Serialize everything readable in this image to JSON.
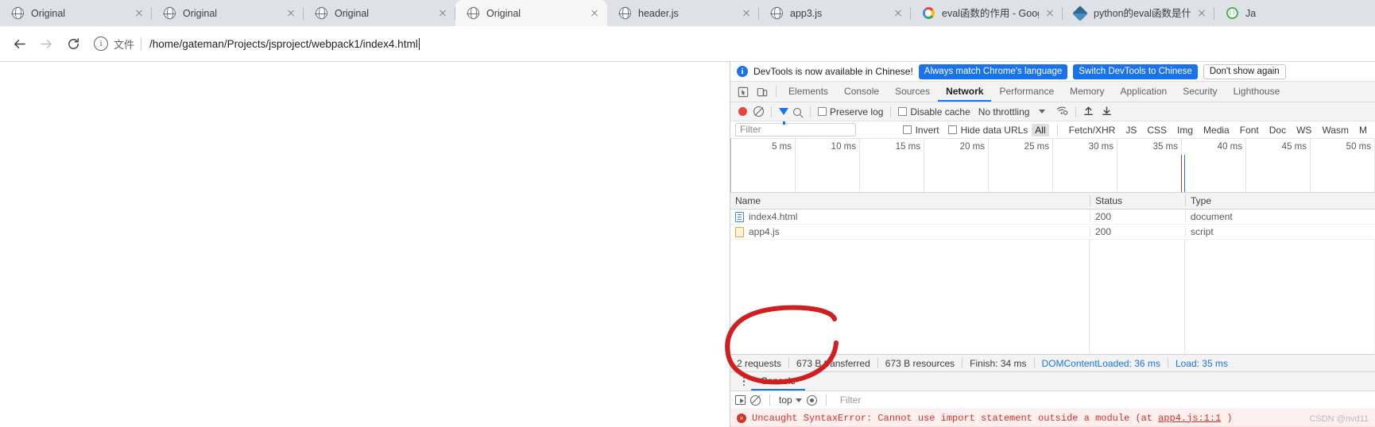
{
  "browser": {
    "tabs": [
      {
        "title": "Original",
        "icon": "globe-icon",
        "active": false
      },
      {
        "title": "Original",
        "icon": "globe-icon",
        "active": false
      },
      {
        "title": "Original",
        "icon": "globe-icon",
        "active": false
      },
      {
        "title": "Original",
        "icon": "globe-icon",
        "active": true
      },
      {
        "title": "header.js",
        "icon": "globe-icon",
        "active": false
      },
      {
        "title": "app3.js",
        "icon": "globe-icon",
        "active": false
      },
      {
        "title": "eval函数的作用 - Goog",
        "icon": "google-icon",
        "active": false
      },
      {
        "title": "python的eval函数是什",
        "icon": "python-icon",
        "active": false
      },
      {
        "title": "Ja",
        "icon": "green-circle-icon",
        "active": false
      }
    ],
    "nav": {
      "back": "←",
      "forward": "→",
      "reload": "⟳"
    },
    "omnibox": {
      "info_icon": "info-icon",
      "scheme_label": "文件",
      "url": "/home/gateman/Projects/jsproject/webpack1/index4.html"
    }
  },
  "devtools": {
    "banner": {
      "message": "DevTools is now available in Chinese!",
      "primary_button": "Always match Chrome's language",
      "secondary_button": "Switch DevTools to Chinese",
      "dismiss_button": "Don't show again"
    },
    "panel_tabs": [
      {
        "label": "Elements",
        "selected": false
      },
      {
        "label": "Console",
        "selected": false
      },
      {
        "label": "Sources",
        "selected": false
      },
      {
        "label": "Network",
        "selected": true
      },
      {
        "label": "Performance",
        "selected": false
      },
      {
        "label": "Memory",
        "selected": false
      },
      {
        "label": "Application",
        "selected": false
      },
      {
        "label": "Security",
        "selected": false
      },
      {
        "label": "Lighthouse",
        "selected": false
      }
    ],
    "network_toolbar": {
      "record_button": "record-icon",
      "clear_button": "clear-icon",
      "filter_button": "funnel-icon",
      "search_button": "search-icon",
      "preserve_log_label": "Preserve log",
      "preserve_log_checked": false,
      "disable_cache_label": "Disable cache",
      "disable_cache_checked": false,
      "throttling_value": "No throttling",
      "wifi_button": "wifi-settings-icon",
      "import_button": "import-har-icon",
      "export_button": "export-har-icon"
    },
    "filter_bar": {
      "filter_placeholder": "Filter",
      "filter_value": "",
      "invert_label": "Invert",
      "invert_checked": false,
      "hide_data_urls_label": "Hide data URLs",
      "hide_data_urls_checked": false,
      "types": [
        {
          "label": "All",
          "selected": true
        },
        {
          "label": "Fetch/XHR",
          "selected": false
        },
        {
          "label": "JS",
          "selected": false
        },
        {
          "label": "CSS",
          "selected": false
        },
        {
          "label": "Img",
          "selected": false
        },
        {
          "label": "Media",
          "selected": false
        },
        {
          "label": "Font",
          "selected": false
        },
        {
          "label": "Doc",
          "selected": false
        },
        {
          "label": "WS",
          "selected": false
        },
        {
          "label": "Wasm",
          "selected": false
        },
        {
          "label": "M",
          "selected": false
        }
      ]
    },
    "overview": {
      "ticks": [
        "5 ms",
        "10 ms",
        "15 ms",
        "20 ms",
        "25 ms",
        "30 ms",
        "35 ms",
        "40 ms",
        "45 ms",
        "50 ms"
      ],
      "markers": [
        {
          "color": "#b23a3a",
          "position_pct": 66.5
        },
        {
          "color": "#1a73e8",
          "position_pct": 67.8
        }
      ]
    },
    "requests_table": {
      "columns": [
        "Name",
        "Status",
        "Type"
      ],
      "rows": [
        {
          "name": "index4.html",
          "icon": "document-icon",
          "status": "200",
          "type": "document"
        },
        {
          "name": "app4.js",
          "icon": "script-icon",
          "status": "200",
          "type": "script"
        }
      ]
    },
    "summary": {
      "requests": "2 requests",
      "transferred": "673 B transferred",
      "resources": "673 B resources",
      "finish": "Finish: 34 ms",
      "dom_content_loaded": "DOMContentLoaded: 36 ms",
      "load": "Load: 35 ms"
    },
    "drawer": {
      "tab_label": "Console",
      "more_button": "kebab-menu-icon",
      "execute_button": "execution-context-icon",
      "clear_button": "clear-console-icon",
      "context_value": "top",
      "eye_button": "live-expression-icon",
      "filter_placeholder": "Filter",
      "messages": [
        {
          "level": "error",
          "text": "Uncaught SyntaxError: Cannot use import statement outside a module (at",
          "link": "app4.js:1:1",
          "suffix": ")"
        }
      ]
    }
  },
  "annotation": {
    "watermark": "CSDN @nvd11"
  }
}
